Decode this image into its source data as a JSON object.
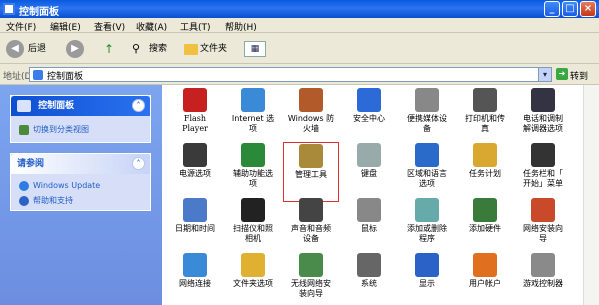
{
  "window": {
    "title": "控制面板"
  },
  "menu": [
    "文件(F)",
    "编辑(E)",
    "查看(V)",
    "收藏(A)",
    "工具(T)",
    "帮助(H)"
  ],
  "toolbar": {
    "back": "后退",
    "search": "搜索",
    "folders": "文件夹"
  },
  "address": {
    "label": "地址(D)",
    "value": "控制面板",
    "go": "转到"
  },
  "sidebar": {
    "panel1": {
      "title": "控制面板",
      "link": "切换到分类视图"
    },
    "panel2": {
      "title": "请参阅",
      "links": [
        "Windows Update",
        "帮助和支持"
      ]
    }
  },
  "items": [
    [
      "Flash",
      "Player"
    ],
    [
      "Internet 选",
      "项"
    ],
    [
      "Windows 防",
      "火墙"
    ],
    [
      "安全中心"
    ],
    [
      "便携媒体设",
      "备"
    ],
    [
      "打印机和传",
      "真"
    ],
    [
      "电话和调制",
      "解调器选项"
    ],
    [
      "电源选项"
    ],
    [
      "辅助功能选",
      "项"
    ],
    [
      "管理工具"
    ],
    [
      "键盘"
    ],
    [
      "区域和语言",
      "选项"
    ],
    [
      "任务计划"
    ],
    [
      "任务栏和「",
      "开始」菜单"
    ],
    [
      "日期和时间"
    ],
    [
      "扫描仪和照",
      "相机"
    ],
    [
      "声音和音频",
      "设备"
    ],
    [
      "鼠标"
    ],
    [
      "添加或删除",
      "程序"
    ],
    [
      "添加硬件"
    ],
    [
      "网络安装向",
      "导"
    ],
    [
      "网络连接"
    ],
    [
      "文件夹选项"
    ],
    [
      "无线网络安",
      "装向导"
    ],
    [
      "系统"
    ],
    [
      "显示"
    ],
    [
      "用户帐户"
    ],
    [
      "游戏控制器"
    ]
  ],
  "colors": {
    "titlebar": "#0a5be0",
    "sidebar": "#7ca5f0",
    "selected_border": "#e03030"
  }
}
